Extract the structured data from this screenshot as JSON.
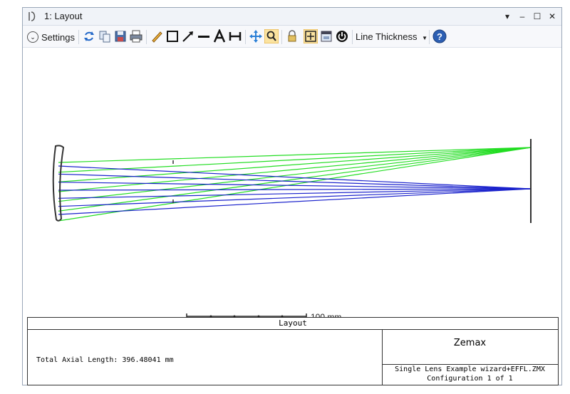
{
  "window": {
    "title": "1: Layout",
    "controls": [
      "▾",
      "–",
      "☐",
      "✕"
    ]
  },
  "toolbar": {
    "settings_label": "Settings",
    "line_thickness_label": "Line Thickness",
    "icons": [
      "refresh-icon",
      "copy-icon",
      "save-icon",
      "print-icon",
      "pencil-icon",
      "rectangle-icon",
      "arrow-icon",
      "line-icon",
      "text-icon",
      "dimension-icon",
      "pan-icon",
      "zoom-icon",
      "lock-icon",
      "fit-icon",
      "window-icon",
      "reset-icon",
      "help-icon"
    ]
  },
  "plot": {
    "scale_label": "100 mm",
    "colors": {
      "green": "#22dd22",
      "blue": "#1a22cc",
      "outline": "#333333"
    }
  },
  "footer": {
    "header": "Layout",
    "total_axial_length_text": "Total Axial Length:  396.48041 mm",
    "brand": "Zemax",
    "file_line": "Single Lens Example wizard+EFFL.ZMX",
    "config_line": "Configuration 1 of 1"
  }
}
